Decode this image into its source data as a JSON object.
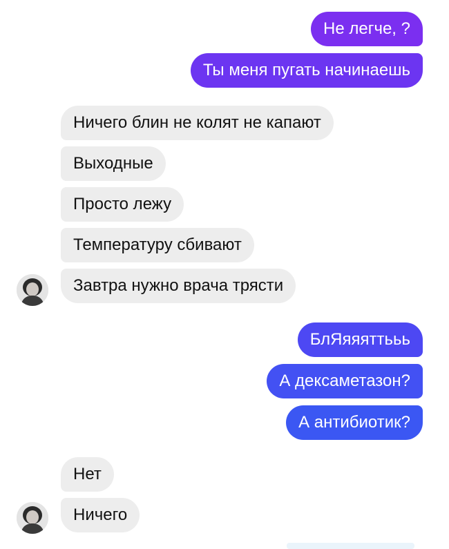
{
  "chat": {
    "messages": [
      {
        "text": "Не легче, ?",
        "sender": "me"
      },
      {
        "text": "Ты меня пугать начинаешь",
        "sender": "me"
      },
      {
        "text": "Ничего блин не колят не капают",
        "sender": "contact"
      },
      {
        "text": "Выходные",
        "sender": "contact"
      },
      {
        "text": "Просто лежу",
        "sender": "contact"
      },
      {
        "text": "Температуру сбивают",
        "sender": "contact"
      },
      {
        "text": "Завтра нужно врача трясти",
        "sender": "contact"
      },
      {
        "text": "БлЯяяяттььь",
        "sender": "me"
      },
      {
        "text": "А дексаметазон?",
        "sender": "me"
      },
      {
        "text": "А антибиотик?",
        "sender": "me"
      },
      {
        "text": "Нет",
        "sender": "contact"
      },
      {
        "text": "Ничего",
        "sender": "contact"
      }
    ]
  },
  "colors": {
    "outgoing_top": "#8a2cf0",
    "outgoing_mid": "#5a3cf2",
    "outgoing_bottom": "#3b57f3",
    "incoming_bg": "#ededed",
    "incoming_text": "#111111"
  },
  "icons": {
    "contact_avatar": "user-avatar-photo"
  }
}
